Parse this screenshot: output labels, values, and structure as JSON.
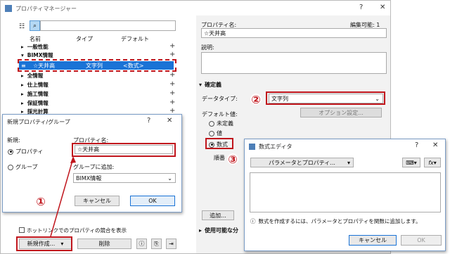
{
  "main": {
    "title": "プロパティマネージャー",
    "help": "?",
    "close": "✕",
    "col_name": "名前",
    "col_type": "タイプ",
    "col_default": "デフォルト",
    "tree": [
      {
        "label": "一般性能"
      },
      {
        "label": "BIMX情報"
      },
      {
        "label": "全情報"
      },
      {
        "label": "仕上情報"
      },
      {
        "label": "施工情報"
      },
      {
        "label": "保証情報"
      },
      {
        "label": "採光計算"
      }
    ],
    "selected": {
      "name": "☆天井高",
      "type": "文字列",
      "default": "<数式>"
    },
    "hotlink_checkbox": "ホットリンクでのプロパティの競合を表示",
    "new_button": "新規作成...",
    "delete_button": "削除",
    "property_name_label": "プロパティ名:",
    "property_name_value": "☆天井高",
    "editable": "編集可能: 1",
    "description_label": "説明:",
    "definition_section": "確定義",
    "datatype_label": "データタイプ:",
    "datatype_value": "文字列",
    "option_button": "オプション設定...",
    "default_label": "デフォルト値:",
    "radio_undefined": "未定義",
    "radio_value": "値",
    "radio_formula": "数式",
    "order_label": "順番",
    "add_button": "追加...",
    "available_section": "使用可能な分"
  },
  "newdlg": {
    "title": "新規プロパティ/グループ",
    "help": "?",
    "close": "✕",
    "new_label": "新規:",
    "radio_property": "プロパティ",
    "radio_group": "グループ",
    "name_label": "プロパティ名:",
    "name_value": "☆天井高",
    "add_to_group_label": "グループに追加:",
    "group_value": "BIMX情報",
    "cancel": "キャンセル",
    "ok": "OK"
  },
  "formula": {
    "title": "数式エディタ",
    "help": "?",
    "close": "✕",
    "param_button": "パラメータとプロパティ...",
    "info": "数式を作成するには、パラメータとプロパティを関数に追加します。",
    "cancel": "キャンセル",
    "ok": "OK"
  },
  "markers": {
    "one": "①",
    "two": "②",
    "three": "③"
  },
  "colors": {
    "annotation_red": "#c0151c",
    "selection_blue": "#1a73d6"
  }
}
